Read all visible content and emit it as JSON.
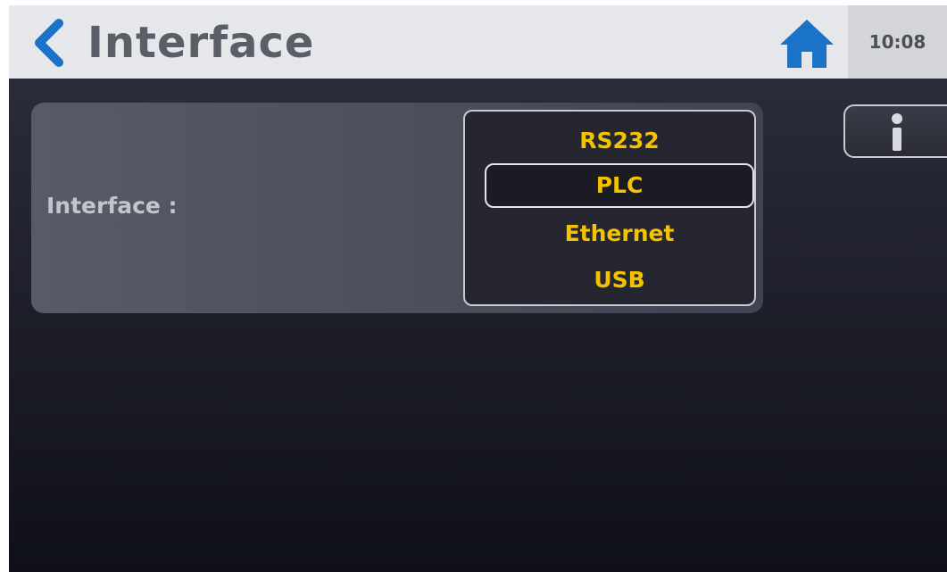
{
  "header": {
    "title": "Interface",
    "clock": "10:08",
    "back_icon": "chevron-left-icon",
    "home_icon": "home-icon",
    "accent_color": "#1a73c8"
  },
  "form": {
    "interface_label": "Interface :"
  },
  "dropdown": {
    "options": [
      "RS232",
      "PLC",
      "Ethernet",
      "USB"
    ],
    "selected": "PLC",
    "option_color": "#f3c200"
  },
  "info_button": {
    "icon": "info-icon"
  }
}
